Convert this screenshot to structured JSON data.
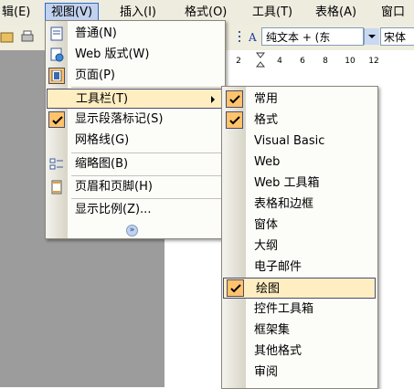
{
  "menubar": {
    "items": [
      {
        "label": "辑(E)"
      },
      {
        "label": "视图(V)"
      },
      {
        "label": "插入(I)"
      },
      {
        "label": "格式(O)"
      },
      {
        "label": "工具(T)"
      },
      {
        "label": "表格(A)"
      },
      {
        "label": "窗口"
      }
    ]
  },
  "toolbar": {
    "style_value": "纯文本 + (东",
    "font_value": "宋体"
  },
  "ruler": {
    "labels": [
      "2",
      "2",
      "4",
      "6",
      "8",
      "10",
      "12"
    ]
  },
  "view_menu": {
    "items": [
      {
        "label": "普通(N)",
        "icon": "normal-view-icon"
      },
      {
        "label": "Web 版式(W)",
        "icon": "web-layout-icon"
      },
      {
        "label": "页面(P)",
        "icon": "page-layout-icon"
      },
      {
        "label": "工具栏(T)"
      },
      {
        "label": "显示段落标记(S)",
        "icon": "check-icon"
      },
      {
        "label": "网格线(G)"
      },
      {
        "label": "缩略图(B)",
        "icon": "thumbnails-icon"
      },
      {
        "label": "页眉和页脚(H)",
        "icon": "header-footer-icon"
      },
      {
        "label": "显示比例(Z)..."
      }
    ]
  },
  "toolbars_submenu": {
    "items": [
      {
        "label": "常用",
        "checked": true
      },
      {
        "label": "格式",
        "checked": true
      },
      {
        "label": "Visual Basic",
        "checked": false
      },
      {
        "label": "Web",
        "checked": false
      },
      {
        "label": "Web 工具箱",
        "checked": false
      },
      {
        "label": "表格和边框",
        "checked": false
      },
      {
        "label": "窗体",
        "checked": false
      },
      {
        "label": "大纲",
        "checked": false
      },
      {
        "label": "电子邮件",
        "checked": false
      },
      {
        "label": "绘图",
        "checked": true
      },
      {
        "label": "控件工具箱",
        "checked": false
      },
      {
        "label": "框架集",
        "checked": false
      },
      {
        "label": "其他格式",
        "checked": false
      },
      {
        "label": "审阅",
        "checked": false
      }
    ]
  },
  "colors": {
    "menu_highlight": "#ffeec2",
    "check_fill": "#ffc36b",
    "menubar_bg": "#eeecdf",
    "workspace_gray": "#9c9c9c"
  }
}
